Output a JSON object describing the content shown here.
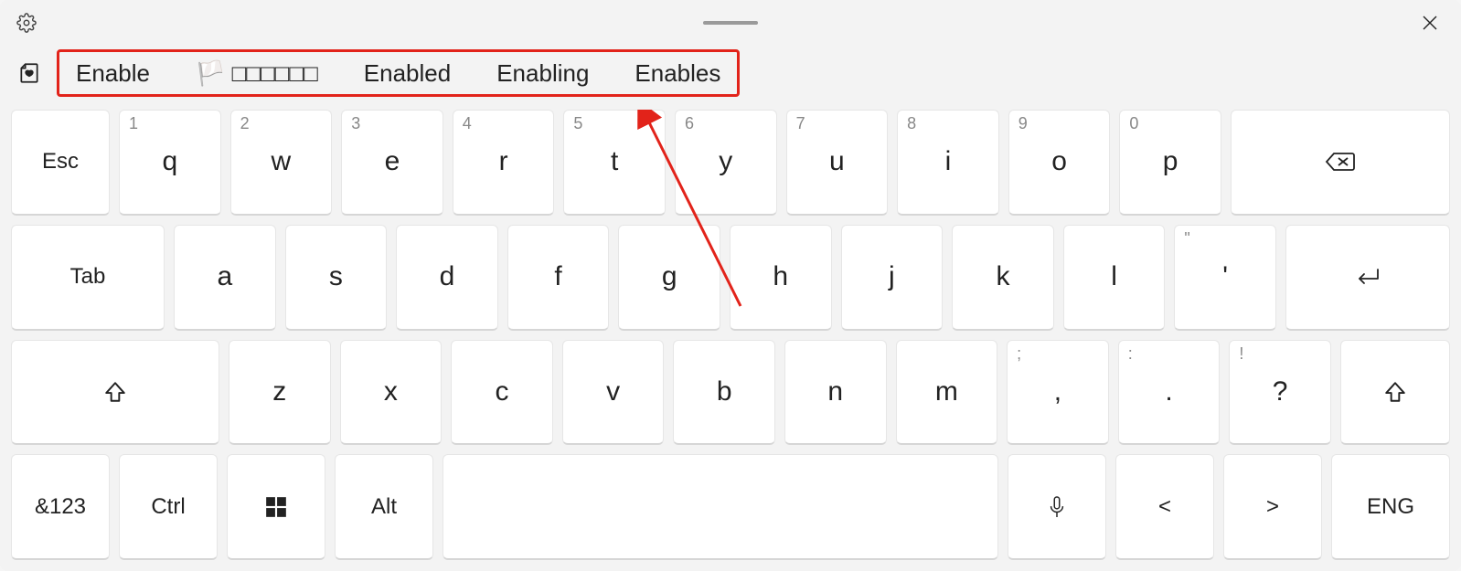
{
  "titlebar": {
    "settings": "settings",
    "close": "close"
  },
  "suggestions": {
    "items": [
      {
        "text": "Enable",
        "emoji": ""
      },
      {
        "text": "🏳️ □□□□□□",
        "emoji": ""
      },
      {
        "text": "Enabled",
        "emoji": ""
      },
      {
        "text": "Enabling",
        "emoji": ""
      },
      {
        "text": "Enables",
        "emoji": ""
      }
    ]
  },
  "rows": {
    "r1": {
      "esc": "Esc",
      "keys": [
        {
          "main": "q",
          "sup": "1"
        },
        {
          "main": "w",
          "sup": "2"
        },
        {
          "main": "e",
          "sup": "3"
        },
        {
          "main": "r",
          "sup": "4"
        },
        {
          "main": "t",
          "sup": "5"
        },
        {
          "main": "y",
          "sup": "6"
        },
        {
          "main": "u",
          "sup": "7"
        },
        {
          "main": "i",
          "sup": "8"
        },
        {
          "main": "o",
          "sup": "9"
        },
        {
          "main": "p",
          "sup": "0"
        }
      ]
    },
    "r2": {
      "tab": "Tab",
      "keys": [
        {
          "main": "a",
          "sup": ""
        },
        {
          "main": "s",
          "sup": ""
        },
        {
          "main": "d",
          "sup": ""
        },
        {
          "main": "f",
          "sup": ""
        },
        {
          "main": "g",
          "sup": ""
        },
        {
          "main": "h",
          "sup": ""
        },
        {
          "main": "j",
          "sup": ""
        },
        {
          "main": "k",
          "sup": ""
        },
        {
          "main": "l",
          "sup": ""
        },
        {
          "main": "'",
          "sup": "\""
        }
      ]
    },
    "r3": {
      "keys": [
        {
          "main": "z",
          "sup": ""
        },
        {
          "main": "x",
          "sup": ""
        },
        {
          "main": "c",
          "sup": ""
        },
        {
          "main": "v",
          "sup": ""
        },
        {
          "main": "b",
          "sup": ""
        },
        {
          "main": "n",
          "sup": ""
        },
        {
          "main": "m",
          "sup": ""
        },
        {
          "main": ",",
          "sup": ";"
        },
        {
          "main": ".",
          "sup": ":"
        },
        {
          "main": "?",
          "sup": "!"
        }
      ]
    },
    "r4": {
      "numsym": "&123",
      "ctrl": "Ctrl",
      "alt": "Alt",
      "left": "<",
      "right": ">",
      "lang": "ENG"
    }
  }
}
